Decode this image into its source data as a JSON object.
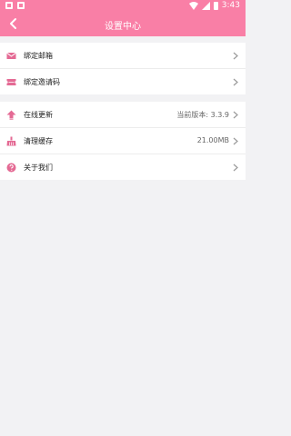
{
  "status_bar": {
    "time": "3:43"
  },
  "header": {
    "title": "设置中心"
  },
  "group1": {
    "items": [
      {
        "label": "绑定邮箱"
      },
      {
        "label": "绑定邀请码"
      }
    ]
  },
  "group2": {
    "items": [
      {
        "label": "在线更新",
        "value": "当前版本: 3.3.9"
      },
      {
        "label": "清理缓存",
        "value": "21.00MB"
      },
      {
        "label": "关于我们"
      }
    ]
  },
  "colors": {
    "accent": "#f97fa6",
    "icon": "#e46a94",
    "background": "#f2f2f4"
  }
}
